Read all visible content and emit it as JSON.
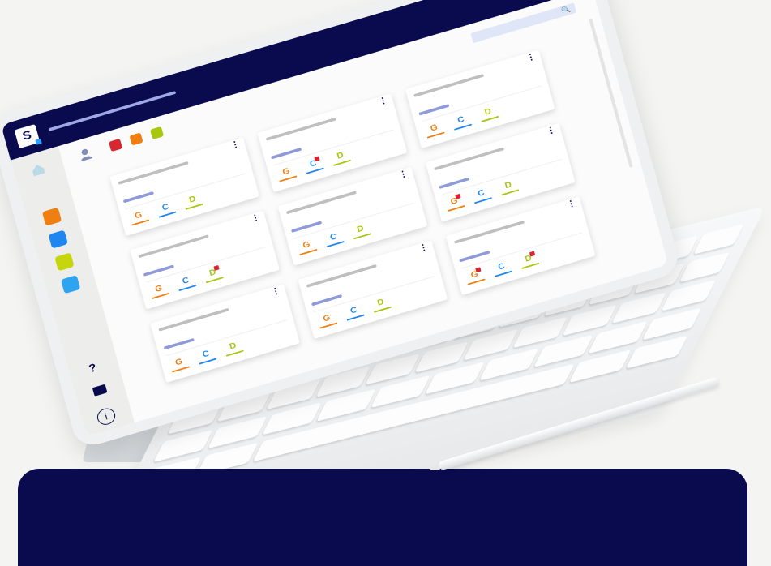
{
  "app": {
    "logo_letter": "S"
  },
  "topbar": {
    "more_icon": "more-icon",
    "apps_icon": "apps-grid-icon",
    "avatar_icon": "avatar"
  },
  "sidebar": {
    "items": [
      {
        "name": "home",
        "icon": "home-icon"
      },
      {
        "name": "orange",
        "color": "#f07f12"
      },
      {
        "name": "blue",
        "color": "#1f86f0"
      },
      {
        "name": "lime",
        "color": "#c5d60f"
      },
      {
        "name": "team",
        "color": "#2ea3f2"
      }
    ],
    "help_label": "?",
    "info_label": "i"
  },
  "legend": [
    {
      "color": "#d9252d"
    },
    {
      "color": "#f07f12"
    },
    {
      "color": "#a8c70f"
    }
  ],
  "status_letters": {
    "g": "G",
    "c": "C",
    "d": "D"
  },
  "colors": {
    "navy": "#0a0b4e",
    "g": "#f07f12",
    "c": "#1f86f0",
    "d": "#a8c70f",
    "flag": "#d9252d"
  },
  "cards": [
    {
      "flags": {
        "g": false,
        "c": false,
        "d": false
      }
    },
    {
      "flags": {
        "g": false,
        "c": true,
        "d": false
      }
    },
    {
      "flags": {
        "g": false,
        "c": false,
        "d": false
      }
    },
    {
      "flags": {
        "g": false,
        "c": false,
        "d": true
      }
    },
    {
      "flags": {
        "g": false,
        "c": false,
        "d": false
      }
    },
    {
      "flags": {
        "g": true,
        "c": false,
        "d": false
      }
    },
    {
      "flags": {
        "g": false,
        "c": false,
        "d": false
      }
    },
    {
      "flags": {
        "g": false,
        "c": false,
        "d": false
      }
    },
    {
      "flags": {
        "g": true,
        "c": false,
        "d": true
      }
    }
  ]
}
